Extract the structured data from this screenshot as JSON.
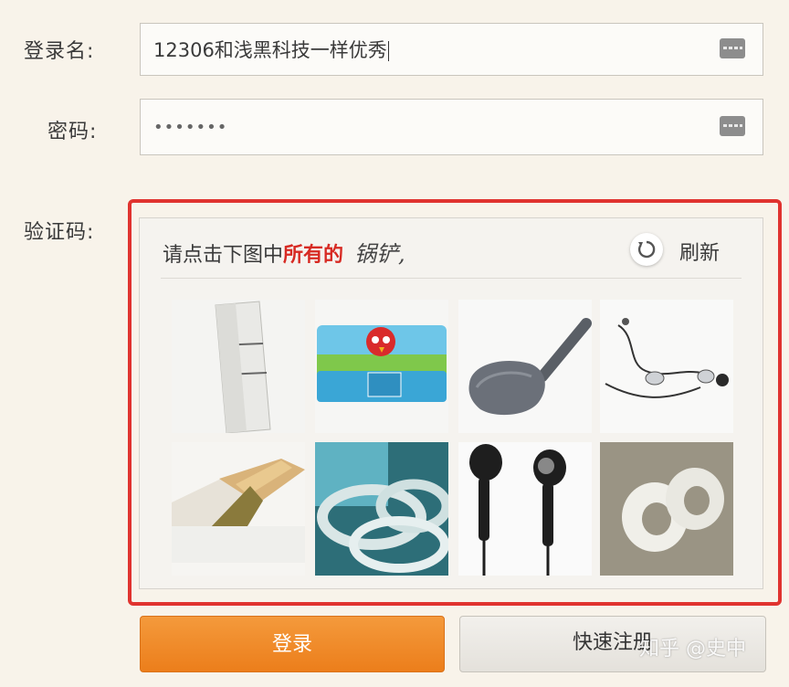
{
  "form": {
    "username_label": "登录名:",
    "username_value": "12306和浅黑科技一样优秀",
    "password_label": "密码:",
    "password_value": "•••••••",
    "captcha_label": "验证码:"
  },
  "captcha": {
    "prompt_plain": "请点击下图中",
    "prompt_emphasis": "所有的",
    "prompt_target": "锅铲,",
    "refresh_label": "刷新",
    "tiles": [
      {
        "subject": "tape-strips-icon"
      },
      {
        "subject": "angry-birds-pencil-case-icon"
      },
      {
        "subject": "spatula-icon"
      },
      {
        "subject": "earphones-icon"
      },
      {
        "subject": "tape-roll-pieces-icon"
      },
      {
        "subject": "tape-rolls-icon"
      },
      {
        "subject": "black-earbuds-icon"
      },
      {
        "subject": "white-tape-rolls-icon"
      }
    ]
  },
  "buttons": {
    "login_label": "登录",
    "register_label": "快速注册"
  },
  "watermark": "知乎 @史中",
  "colors": {
    "captcha_border": "#e0332f",
    "prompt_emphasis": "#d72a23",
    "login_button": "#ec7e1b"
  }
}
